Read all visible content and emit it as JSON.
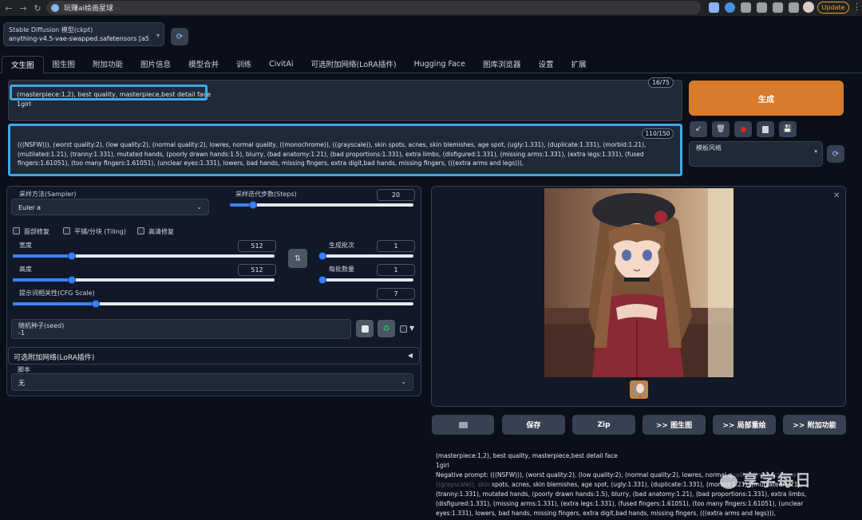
{
  "browser": {
    "tab_title": "玩赚ai绘画星球",
    "update_label": "Update"
  },
  "checkpoint": {
    "label": "Stable Diffusion 模型(ckpt)",
    "value": "anything-v4.5-vae-swapped.safetensors [a504b5"
  },
  "tabs": [
    "文生图",
    "图生图",
    "附加功能",
    "图片信息",
    "模型合并",
    "训练",
    "CivitAi",
    "可选附加网络(LoRA插件)",
    "Hugging Face",
    "图库浏览器",
    "设置",
    "扩展"
  ],
  "prompt": {
    "line1": "(masterpiece:1,2), best quality, masterpiece,best detail face",
    "line2": "1girl",
    "counter": "16/75"
  },
  "negative_prompt": {
    "text": "(((NSFW))), (worst quality:2), (low quality:2), (normal quality:2), lowres, normal quality, ((monochrome)), ((grayscale)), skin spots, acnes, skin blemishes, age spot, (ugly:1.331), (duplicate:1.331), (morbid:1.21), (mutilated:1.21), (tranny:1.331), mutated hands, (poorly drawn hands:1.5), blurry, (bad anatomy:1.21), (bad proportions:1.331), extra limbs, (disfigured:1.331), (missing arms:1.331), (extra legs:1.331), (fused fingers:1.61051), (too many fingers:1.61051), (unclear eyes:1.331), lowers, bad hands, missing fingers, extra digit,bad hands, missing fingers, (((extra arms and legs))),",
    "counter": "110/150"
  },
  "generate": {
    "label": "生成",
    "style_label": "模板风格"
  },
  "sampler": {
    "label": "采样方法(Sampler)",
    "value": "Euler a"
  },
  "steps": {
    "label": "采样迭代步数(Steps)",
    "value": "20",
    "min": 1,
    "max": 150,
    "current": 20
  },
  "options": {
    "restore_faces": "面部修复",
    "tiling": "平铺/分块 (Tiling)",
    "hires": "高清修复"
  },
  "width": {
    "label": "宽度",
    "value": "512",
    "current": 512,
    "min": 64,
    "max": 2048
  },
  "height": {
    "label": "高度",
    "value": "512",
    "current": 512,
    "min": 64,
    "max": 2048
  },
  "batch_count": {
    "label": "生成批次",
    "value": "1",
    "current": 1,
    "min": 1,
    "max": 100
  },
  "batch_size": {
    "label": "每批数量",
    "value": "1",
    "current": 1,
    "min": 1,
    "max": 8
  },
  "cfg": {
    "label": "提示词相关性(CFG Scale)",
    "value": "7",
    "current": 7,
    "min": 1,
    "max": 30
  },
  "seed": {
    "label": "随机种子(seed)",
    "value": "-1"
  },
  "lora": {
    "label": "可选附加网络(LoRA插件)"
  },
  "script": {
    "label": "脚本",
    "value": "无"
  },
  "output_buttons": [
    "保存",
    "Zip",
    ">> 图生图",
    ">> 局部重绘",
    ">> 附加功能"
  ],
  "info": {
    "line1": "(masterpiece:1,2), best quality, masterpiece,best detail face",
    "line2": "1girl",
    "negative": "Negative prompt: (((NSFW))), (worst quality:2), (low quality:2), (normal quality:2), lowres, normal q",
    "negative_hidden": "uality, ((monochrome)), ((grayscale)), skin",
    "rest": "spots, acnes, skin blemishes, age spot, (ugly:1.331), (duplicate:1.331), (morbid:1.21), (mutilated:1.21), (tranny:1.331), mutated hands, (poorly drawn hands:1.5), blurry, (bad anatomy:1.21), (bad proportions:1.331), extra limbs, (disfigured:1.331), (missing arms:1.331), (extra legs:1.331), (fused fingers:1.61051), (too many fingers:1.61051), (unclear eyes:1.331), lowers, bad hands, missing fingers, extra digit,bad hands, missing fingers, (((extra arms and legs))),"
  },
  "watermark": "享学每日",
  "colors": {
    "accent_orange": "#d97b2a",
    "highlight_blue": "#3da9e8",
    "bg": "#0b0f19",
    "slider": "#3b82f6"
  }
}
